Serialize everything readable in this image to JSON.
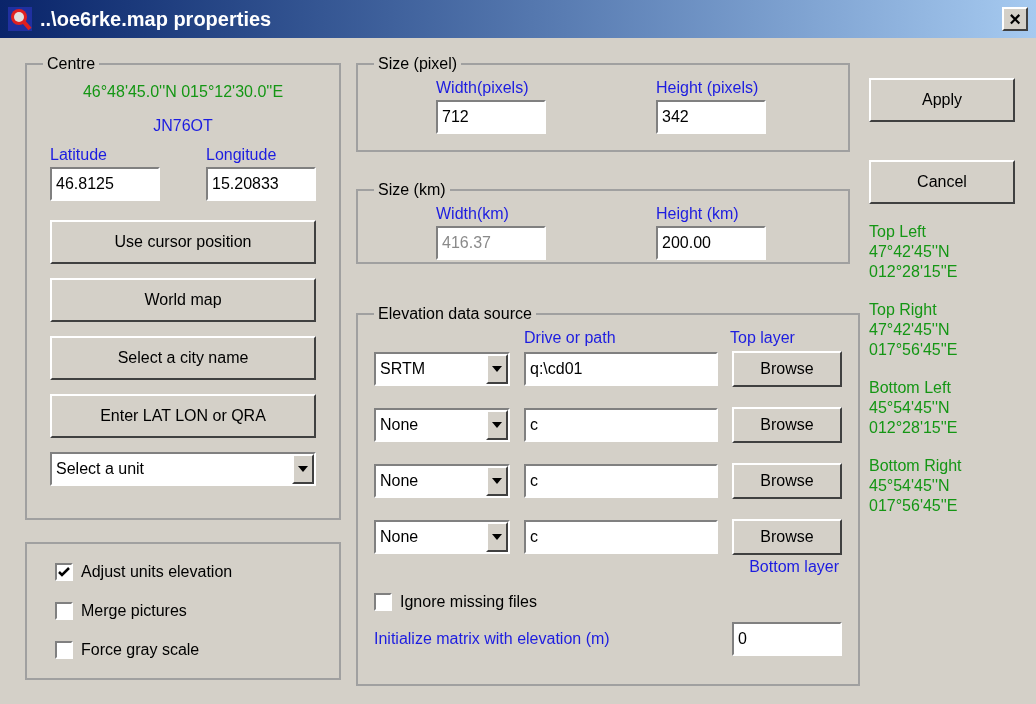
{
  "window": {
    "title": "..\\oe6rke.map properties",
    "close": "×"
  },
  "centre": {
    "title": "Centre",
    "coordinates": "46°48'45.0''N 015°12'30.0''E",
    "locator": "JN76OT",
    "latitude": {
      "label": "Latitude",
      "value": "46.8125"
    },
    "longitude": {
      "label": "Longitude",
      "value": "15.20833"
    },
    "buttons": [
      "Use cursor position",
      "World map",
      "Select a city name",
      "Enter LAT LON or QRA"
    ],
    "unit_select": {
      "value": "Select a unit"
    }
  },
  "options": [
    {
      "label": "Adjust units elevation",
      "checked": true
    },
    {
      "label": "Merge pictures",
      "checked": false
    },
    {
      "label": "Force gray scale",
      "checked": false
    }
  ],
  "size_pixel": {
    "title": "Size (pixel)",
    "fields": [
      {
        "label": "Width(pixels)",
        "value": "712",
        "disabled": false
      },
      {
        "label": "Height (pixels)",
        "value": "342",
        "disabled": false
      }
    ]
  },
  "size_km": {
    "title": "Size (km)",
    "fields": [
      {
        "label": "Width(km)",
        "value": "416.37",
        "disabled": true
      },
      {
        "label": "Height (km)",
        "value": "200.00",
        "disabled": false
      }
    ]
  },
  "elevation": {
    "title": "Elevation data source",
    "path_header": "Drive or path",
    "top_label": "Top layer",
    "bottom_label": "Bottom layer",
    "rows": [
      {
        "source": "SRTM",
        "path": "q:\\cd01",
        "browse": "Browse"
      },
      {
        "source": "None",
        "path": "c",
        "browse": "Browse"
      },
      {
        "source": "None",
        "path": "c",
        "browse": "Browse"
      },
      {
        "source": "None",
        "path": "c",
        "browse": "Browse"
      }
    ],
    "ignore_missing": {
      "label": "Ignore missing files",
      "checked": false
    },
    "init": {
      "label": "Initialize matrix with elevation (m)",
      "value": "0"
    }
  },
  "actions": [
    "Apply",
    "Cancel"
  ],
  "corners": [
    {
      "label": "Top Left",
      "lat": "47°42'45''N",
      "lon": "012°28'15''E"
    },
    {
      "label": "Top Right",
      "lat": "47°42'45''N",
      "lon": "017°56'45''E"
    },
    {
      "label": "Bottom Left",
      "lat": "45°54'45''N",
      "lon": "012°28'15''E"
    },
    {
      "label": "Bottom Right",
      "lat": "45°54'45''N",
      "lon": "017°56'45''E"
    }
  ]
}
